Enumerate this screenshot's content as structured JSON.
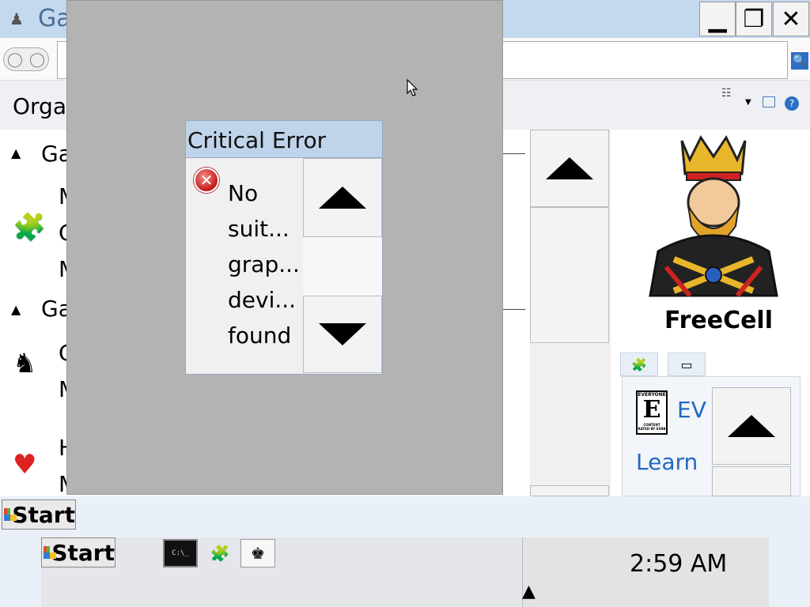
{
  "window": {
    "title": "Ga",
    "buttons": {
      "minimize": "▁",
      "maximize": "❐",
      "close": "✕"
    }
  },
  "toolbar": {
    "organize_label": "Orga",
    "search_glyph": "🔍",
    "help_glyph": "?"
  },
  "game_list": {
    "groups": [
      {
        "label": "Ga",
        "letters": [
          "M",
          "C",
          "M"
        ]
      },
      {
        "label": "Ga",
        "letters": [
          "C",
          "M",
          "H",
          "M"
        ]
      }
    ],
    "icons": [
      "puzzle-icon",
      "chess-icon",
      "hearts-icon"
    ]
  },
  "preview": {
    "game_name": "FreeCell",
    "rating_text": "EV",
    "learn_text": "Learn",
    "esrb_top": "EVERYONE",
    "esrb_letter": "E",
    "esrb_bottom": "CONTENT RATED BY ESRB"
  },
  "dialog": {
    "title": "Critical Error",
    "message_lines": [
      "No",
      "suit...",
      "grap...",
      "devi...",
      "found"
    ]
  },
  "taskbar": {
    "start_label": "Start",
    "start_label_2": "Start",
    "cmd_icon_text": "C:\\_",
    "clock": "2:59 AM"
  },
  "colors": {
    "title_bar": "#c4d8ee",
    "overlay": "#b3b3b3",
    "dialog_title": "#bfd3ea",
    "link": "#2168c0",
    "error_red": "#c41a1a"
  }
}
